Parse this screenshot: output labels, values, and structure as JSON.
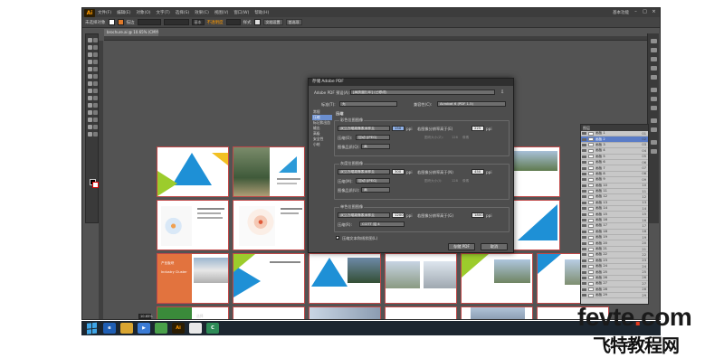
{
  "app": {
    "logo": "Ai",
    "menu": [
      "文件(F)",
      "编辑(E)",
      "对象(O)",
      "文字(T)",
      "选择(S)",
      "效果(C)",
      "视图(V)",
      "窗口(W)",
      "帮助(H)"
    ],
    "workspace": "基本功能",
    "window_controls": [
      "minimize-icon",
      "restore-icon",
      "close-icon"
    ]
  },
  "control_bar": {
    "selection_label": "未选择对象",
    "stroke_label": "描边",
    "stroke_value": "基本",
    "opacity_label": "不透明度",
    "style_label": "样式",
    "doc_setup_button": "文档设置",
    "preferences_button": "首选项"
  },
  "document": {
    "tab_label": "brochure.ai @ 10.65% (CMYK/预览)"
  },
  "dialog": {
    "title": "存储 Adobe PDF",
    "preset_label": "Adobe PDF 预设(A):",
    "preset_value": "[高质量打印] (已修改)",
    "standard_label": "标准(T):",
    "standard_value": "无",
    "compat_label": "兼容性(C):",
    "compat_value": "Acrobat 6 (PDF 1.5)",
    "nav": [
      "常规",
      "压缩",
      "标记和出血",
      "输出",
      "高级",
      "安全性",
      "小结"
    ],
    "nav_active_index": 1,
    "section_title": "压缩",
    "groups": [
      {
        "title": "彩色位图图像",
        "resample": "双立方缩减像素采样至",
        "ppi_value": "150",
        "ppi_unit": "ppi",
        "above_label": "若图像分辨率高于(E)",
        "above_value": "225",
        "compression_label": "压缩(O):",
        "compression_value": "自动 (JPEG)",
        "tile_label": "图块大小(Z):",
        "tile_value": "128",
        "tile_unit": "像素",
        "quality_label": "图像品质(Q):",
        "quality_value": "高"
      },
      {
        "title": "灰度位图图像",
        "resample": "双立方缩减像素采样至",
        "ppi_value": "300",
        "ppi_unit": "ppi",
        "above_label": "若图像分辨率高于(N)",
        "above_value": "450",
        "compression_label": "压缩(M):",
        "compression_value": "自动 (JPEG)",
        "tile_label": "图块大小(I):",
        "tile_value": "128",
        "tile_unit": "像素",
        "quality_label": "图像品质(U):",
        "quality_value": "高"
      },
      {
        "title": "单色位图图像",
        "resample": "双立方缩减像素采样至",
        "ppi_value": "1200",
        "ppi_unit": "ppi",
        "above_label": "若图像分辨率高于(G)",
        "above_value": "1800",
        "compression_label": "压缩(R):",
        "compression_value": "CCITT 组 4"
      }
    ],
    "checkbox_label": "压缩文本和线状图(L)",
    "save_button": "存储 PDF",
    "cancel_button": "取消"
  },
  "layers_panel": {
    "tab_label": "图层",
    "rows": [
      {
        "name": "画板 1",
        "count": "01"
      },
      {
        "name": "画板 2",
        "count": "02"
      },
      {
        "name": "画板 3",
        "count": "03"
      },
      {
        "name": "画板 4",
        "count": "04"
      },
      {
        "name": "画板 5",
        "count": "05"
      },
      {
        "name": "画板 6",
        "count": "06"
      },
      {
        "name": "画板 7",
        "count": "07"
      },
      {
        "name": "画板 8",
        "count": "08"
      },
      {
        "name": "画板 9",
        "count": "09"
      },
      {
        "name": "画板 10",
        "count": "10"
      },
      {
        "name": "画板 11",
        "count": "11"
      },
      {
        "name": "画板 12",
        "count": "12"
      },
      {
        "name": "画板 13",
        "count": "13"
      },
      {
        "name": "画板 14",
        "count": "14"
      },
      {
        "name": "画板 15",
        "count": "15"
      },
      {
        "name": "画板 16",
        "count": "16"
      },
      {
        "name": "画板 17",
        "count": "17"
      },
      {
        "name": "画板 18",
        "count": "18"
      },
      {
        "name": "画板 19",
        "count": "19"
      },
      {
        "name": "画板 20",
        "count": "20"
      },
      {
        "name": "画板 21",
        "count": "21"
      },
      {
        "name": "画板 22",
        "count": "22"
      },
      {
        "name": "画板 23",
        "count": "23"
      },
      {
        "name": "画板 24",
        "count": "24"
      },
      {
        "name": "画板 25",
        "count": "25"
      },
      {
        "name": "画板 26",
        "count": "26"
      },
      {
        "name": "画板 27",
        "count": "27"
      },
      {
        "name": "画板 28",
        "count": "28"
      },
      {
        "name": "画板 29",
        "count": "29"
      }
    ],
    "selected_index": 1
  },
  "status_bar": {
    "zoom": "10.65%",
    "mode": "选择"
  },
  "artboard_texts": {
    "cover_en": "Industry Cluster",
    "cover_cn": "产业板块"
  },
  "taskbar": {
    "icons": [
      "ie-icon",
      "explorer-icon",
      "media-icon",
      "green-app-icon",
      "illustrator-icon",
      "white-app-icon",
      "green-c-icon"
    ],
    "illustrator_label": "Ai"
  },
  "watermark": {
    "domain_left": "fevte",
    "domain_dot": ".",
    "domain_right": "com",
    "cn": "飞特教程网"
  },
  "colors": {
    "ai_orange": "#ff9a00",
    "dialog_bg": "#4d4d4d",
    "app_bg": "#535353",
    "selection_blue": "#5a7cc7",
    "watermark_red": "#e63a1d"
  }
}
